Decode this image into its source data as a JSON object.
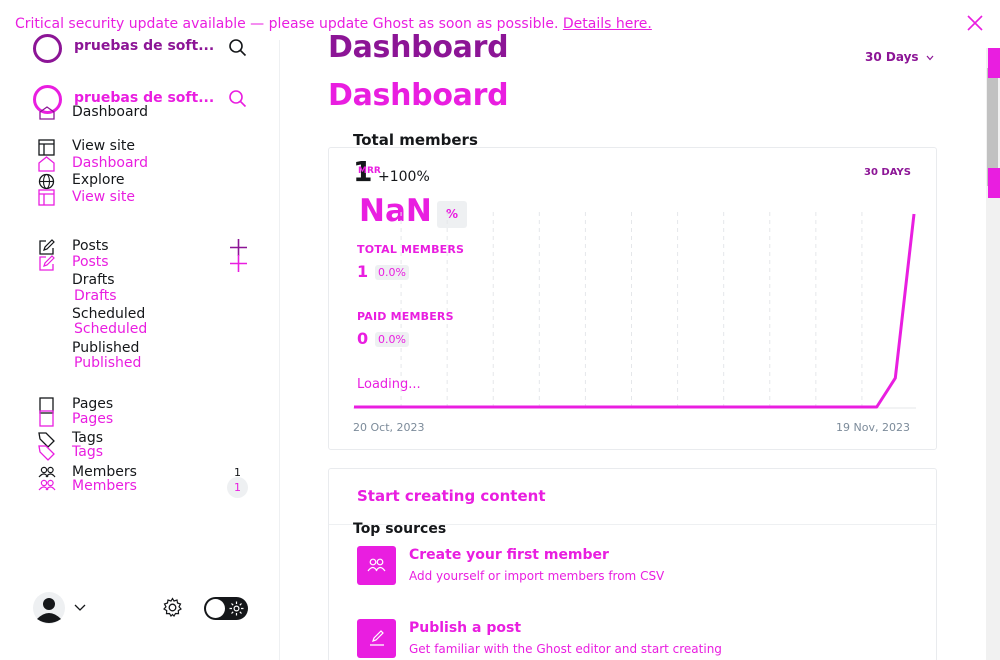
{
  "banner": {
    "text": "Critical security update available — please update Ghost as soon as possible.",
    "link": "Details here."
  },
  "site": {
    "name": "pruebas de soft..."
  },
  "nav": {
    "dashboard": "Dashboard",
    "view_site": "View site",
    "explore": "Explore",
    "posts": "Posts",
    "drafts": "Drafts",
    "scheduled": "Scheduled",
    "published": "Published",
    "pages": "Pages",
    "tags": "Tags",
    "members": "Members",
    "members_count": "1"
  },
  "header": {
    "title": "Dashboard",
    "range": "30 Days"
  },
  "members_card": {
    "heading": "Total members",
    "big_number": "1",
    "mrr": "MRR",
    "change": "+100%",
    "range_label": "30 DAYS",
    "nan": "NaN",
    "percent": "%",
    "total_label": "TOTAL MEMBERS",
    "total_value": "1",
    "total_change": "0.0%",
    "paid_label": "PAID MEMBERS",
    "paid_value": "0",
    "paid_change": "0.0%",
    "loading": "Loading...",
    "date_start": "20 Oct, 2023",
    "date_end": "19 Nov, 2023"
  },
  "content_card": {
    "title": "Start creating content",
    "top_sources": "Top sources",
    "items": [
      {
        "title": "Create your first member",
        "desc": "Add yourself or import members from CSV"
      },
      {
        "title": "Publish a post",
        "desc": "Get familiar with the Ghost editor and start creating"
      }
    ]
  },
  "chart_data": {
    "type": "line",
    "x": [
      "20 Oct, 2023",
      "19 Nov, 2023"
    ],
    "series": [
      {
        "values": [
          0,
          0,
          0,
          0,
          0,
          0,
          0,
          0,
          0,
          0,
          0,
          0,
          0,
          0,
          0,
          0,
          0,
          0,
          0,
          0,
          0,
          0,
          0,
          0,
          0,
          0,
          0,
          0,
          0,
          0.15,
          1
        ]
      }
    ],
    "color": "#e91ee0"
  }
}
